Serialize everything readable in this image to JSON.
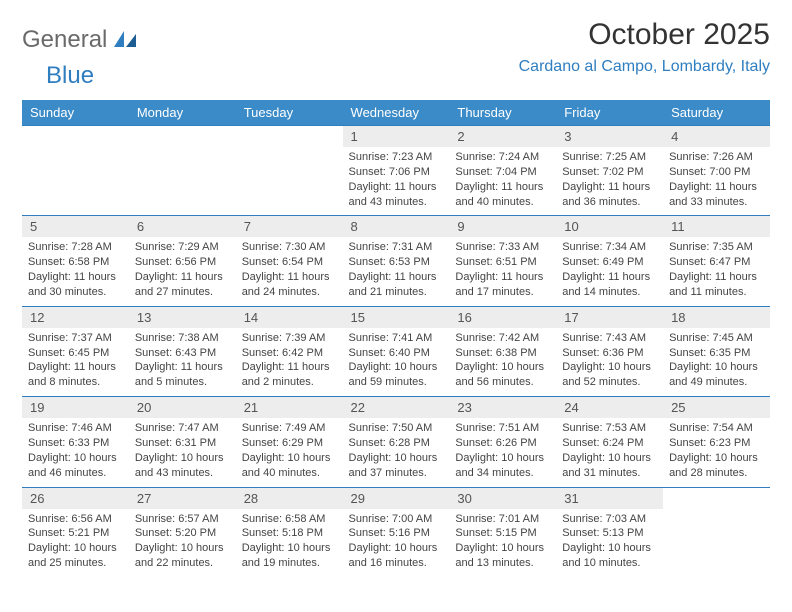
{
  "logo": {
    "text1": "General",
    "text2": "Blue"
  },
  "title": "October 2025",
  "location": "Cardano al Campo, Lombardy, Italy",
  "weekdays": [
    "Sunday",
    "Monday",
    "Tuesday",
    "Wednesday",
    "Thursday",
    "Friday",
    "Saturday"
  ],
  "weeks": [
    [
      null,
      null,
      null,
      {
        "n": "1",
        "sr": "7:23 AM",
        "ss": "7:06 PM",
        "dl": "11 hours and 43 minutes."
      },
      {
        "n": "2",
        "sr": "7:24 AM",
        "ss": "7:04 PM",
        "dl": "11 hours and 40 minutes."
      },
      {
        "n": "3",
        "sr": "7:25 AM",
        "ss": "7:02 PM",
        "dl": "11 hours and 36 minutes."
      },
      {
        "n": "4",
        "sr": "7:26 AM",
        "ss": "7:00 PM",
        "dl": "11 hours and 33 minutes."
      }
    ],
    [
      {
        "n": "5",
        "sr": "7:28 AM",
        "ss": "6:58 PM",
        "dl": "11 hours and 30 minutes."
      },
      {
        "n": "6",
        "sr": "7:29 AM",
        "ss": "6:56 PM",
        "dl": "11 hours and 27 minutes."
      },
      {
        "n": "7",
        "sr": "7:30 AM",
        "ss": "6:54 PM",
        "dl": "11 hours and 24 minutes."
      },
      {
        "n": "8",
        "sr": "7:31 AM",
        "ss": "6:53 PM",
        "dl": "11 hours and 21 minutes."
      },
      {
        "n": "9",
        "sr": "7:33 AM",
        "ss": "6:51 PM",
        "dl": "11 hours and 17 minutes."
      },
      {
        "n": "10",
        "sr": "7:34 AM",
        "ss": "6:49 PM",
        "dl": "11 hours and 14 minutes."
      },
      {
        "n": "11",
        "sr": "7:35 AM",
        "ss": "6:47 PM",
        "dl": "11 hours and 11 minutes."
      }
    ],
    [
      {
        "n": "12",
        "sr": "7:37 AM",
        "ss": "6:45 PM",
        "dl": "11 hours and 8 minutes."
      },
      {
        "n": "13",
        "sr": "7:38 AM",
        "ss": "6:43 PM",
        "dl": "11 hours and 5 minutes."
      },
      {
        "n": "14",
        "sr": "7:39 AM",
        "ss": "6:42 PM",
        "dl": "11 hours and 2 minutes."
      },
      {
        "n": "15",
        "sr": "7:41 AM",
        "ss": "6:40 PM",
        "dl": "10 hours and 59 minutes."
      },
      {
        "n": "16",
        "sr": "7:42 AM",
        "ss": "6:38 PM",
        "dl": "10 hours and 56 minutes."
      },
      {
        "n": "17",
        "sr": "7:43 AM",
        "ss": "6:36 PM",
        "dl": "10 hours and 52 minutes."
      },
      {
        "n": "18",
        "sr": "7:45 AM",
        "ss": "6:35 PM",
        "dl": "10 hours and 49 minutes."
      }
    ],
    [
      {
        "n": "19",
        "sr": "7:46 AM",
        "ss": "6:33 PM",
        "dl": "10 hours and 46 minutes."
      },
      {
        "n": "20",
        "sr": "7:47 AM",
        "ss": "6:31 PM",
        "dl": "10 hours and 43 minutes."
      },
      {
        "n": "21",
        "sr": "7:49 AM",
        "ss": "6:29 PM",
        "dl": "10 hours and 40 minutes."
      },
      {
        "n": "22",
        "sr": "7:50 AM",
        "ss": "6:28 PM",
        "dl": "10 hours and 37 minutes."
      },
      {
        "n": "23",
        "sr": "7:51 AM",
        "ss": "6:26 PM",
        "dl": "10 hours and 34 minutes."
      },
      {
        "n": "24",
        "sr": "7:53 AM",
        "ss": "6:24 PM",
        "dl": "10 hours and 31 minutes."
      },
      {
        "n": "25",
        "sr": "7:54 AM",
        "ss": "6:23 PM",
        "dl": "10 hours and 28 minutes."
      }
    ],
    [
      {
        "n": "26",
        "sr": "6:56 AM",
        "ss": "5:21 PM",
        "dl": "10 hours and 25 minutes."
      },
      {
        "n": "27",
        "sr": "6:57 AM",
        "ss": "5:20 PM",
        "dl": "10 hours and 22 minutes."
      },
      {
        "n": "28",
        "sr": "6:58 AM",
        "ss": "5:18 PM",
        "dl": "10 hours and 19 minutes."
      },
      {
        "n": "29",
        "sr": "7:00 AM",
        "ss": "5:16 PM",
        "dl": "10 hours and 16 minutes."
      },
      {
        "n": "30",
        "sr": "7:01 AM",
        "ss": "5:15 PM",
        "dl": "10 hours and 13 minutes."
      },
      {
        "n": "31",
        "sr": "7:03 AM",
        "ss": "5:13 PM",
        "dl": "10 hours and 10 minutes."
      },
      null
    ]
  ],
  "labels": {
    "sunrise": "Sunrise: ",
    "sunset": "Sunset: ",
    "daylight": "Daylight: "
  }
}
